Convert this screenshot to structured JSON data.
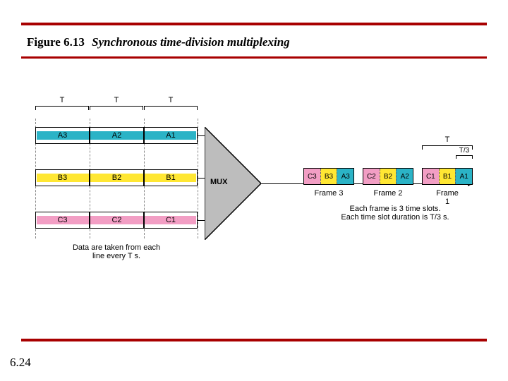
{
  "title": {
    "fig_number": "Figure 6.13",
    "caption": "Synchronous time-division multiplexing"
  },
  "page_number": "6.24",
  "colors": {
    "A": "#2bb3c6",
    "B": "#ffe733",
    "C": "#f29ec4",
    "rule": "#a80000"
  },
  "diagram": {
    "input": {
      "period_labels": [
        "T",
        "T",
        "T"
      ],
      "rows": [
        {
          "name": "A",
          "cells": [
            "A3",
            "A2",
            "A1"
          ]
        },
        {
          "name": "B",
          "cells": [
            "B3",
            "B2",
            "B1"
          ]
        },
        {
          "name": "C",
          "cells": [
            "C3",
            "C2",
            "C1"
          ]
        }
      ],
      "note": "Data are taken from each\nline every T s."
    },
    "mux_label": "MUX",
    "output": {
      "period_label": "T",
      "slot_label": "T/3",
      "frames": [
        {
          "label": "Frame 3",
          "slots": [
            "C3",
            "B3",
            "A3"
          ]
        },
        {
          "label": "Frame 2",
          "slots": [
            "C2",
            "B2",
            "A2"
          ]
        },
        {
          "label": "Frame 1",
          "slots": [
            "C1",
            "B1",
            "A1"
          ]
        }
      ],
      "note": "Each frame is 3 time slots.\nEach time slot duration is T/3 s."
    }
  }
}
